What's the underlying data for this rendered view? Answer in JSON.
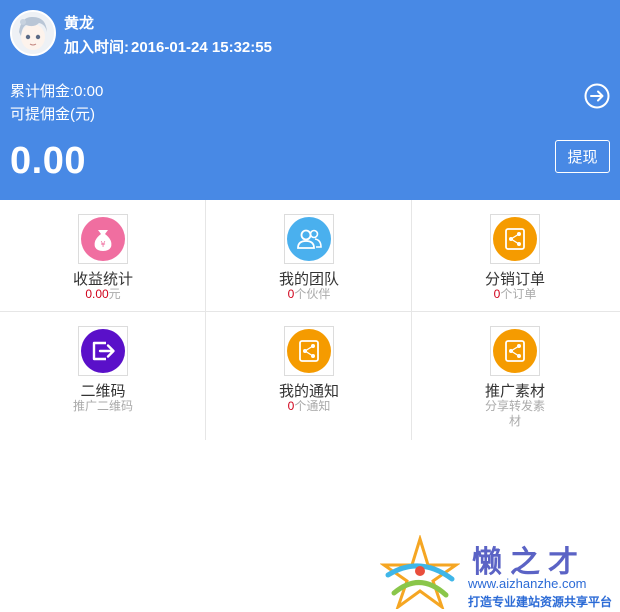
{
  "header": {
    "user_name": "黄龙",
    "join_label": "加入时间:",
    "join_time": "2016-01-24 15:32:55",
    "total_commission": "累计佣金:0:00",
    "withdrawable_label": "可提佣金(元)",
    "balance": "0.00",
    "withdraw_button": "提现",
    "arrow_icon": "arrow-right-circle-icon",
    "avatar_icon": "anime-avatar"
  },
  "menu": {
    "items": [
      {
        "title": "收益统计",
        "value": "0.00",
        "unit": "元",
        "icon": "money-bag-icon",
        "color": "#f06ea0"
      },
      {
        "title": "我的团队",
        "value": "0",
        "unit": "个伙伴",
        "icon": "team-icon",
        "color": "#4ab0ee"
      },
      {
        "title": "分销订单",
        "value": "0",
        "unit": "个订单",
        "icon": "share-icon",
        "color": "#f59b00"
      },
      {
        "title": "二维码",
        "subtitle": "推广二维码",
        "icon": "exit-icon",
        "color": "#5a10c9"
      },
      {
        "title": "我的通知",
        "value": "0",
        "unit": "个通知",
        "icon": "share-icon",
        "color": "#f59b00"
      },
      {
        "title": "推广素材",
        "subtitle": "分享转发素材",
        "icon": "share-icon",
        "color": "#f59b00"
      }
    ]
  },
  "watermark": {
    "title": "懒之才",
    "url": "www.aizhanzhe.com",
    "slogan": "打造专业建站资源共享平台"
  }
}
